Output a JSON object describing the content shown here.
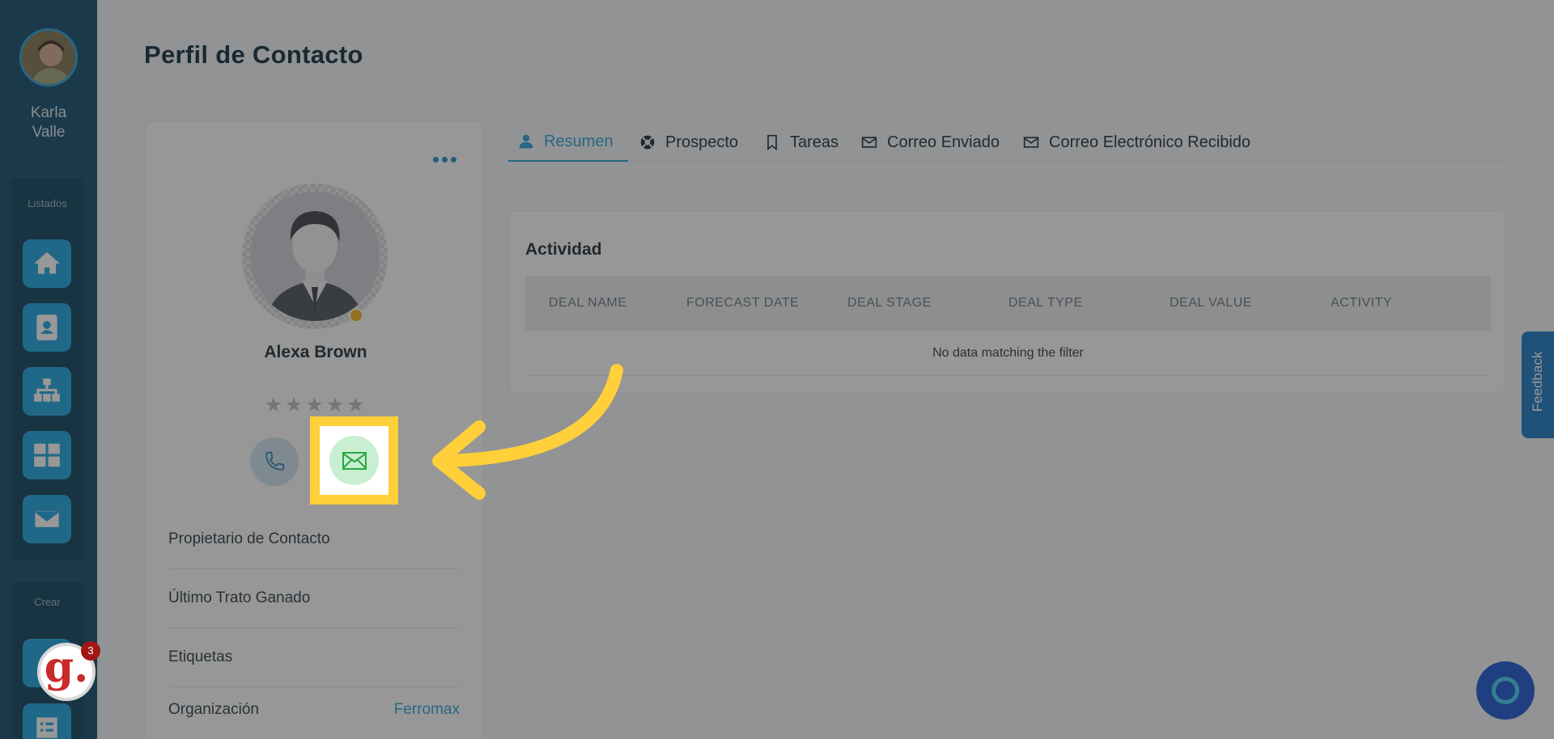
{
  "sidebar": {
    "user_name": "Karla Valle",
    "list_label": "Listados",
    "create_label": "Crear",
    "items": [
      {
        "icon": "home-icon"
      },
      {
        "icon": "contact-card-icon"
      },
      {
        "icon": "org-chart-icon"
      },
      {
        "icon": "grid-icon"
      },
      {
        "icon": "mail-icon"
      }
    ]
  },
  "page": {
    "title": "Perfil de Contacto"
  },
  "contact": {
    "name": "Alexa Brown",
    "rating": "★★★★★",
    "fields": [
      {
        "label": "Propietario de Contacto",
        "value": ""
      },
      {
        "label": "Último Trato Ganado",
        "value": ""
      },
      {
        "label": "Etiquetas",
        "value": ""
      },
      {
        "label": "Organización",
        "value": "Ferromax"
      }
    ]
  },
  "tabs": [
    {
      "label": "Resumen",
      "icon": "user-icon"
    },
    {
      "label": "Prospecto",
      "icon": "lifebuoy-icon"
    },
    {
      "label": "Tareas",
      "icon": "bookmark-icon"
    },
    {
      "label": "Correo Enviado",
      "icon": "mail-icon"
    },
    {
      "label": "Correo Electrónico Recibido",
      "icon": "mail-icon"
    }
  ],
  "activity": {
    "title": "Actividad",
    "columns": [
      "DEAL NAME",
      "FORECAST DATE",
      "DEAL STAGE",
      "DEAL TYPE",
      "DEAL VALUE",
      "ACTIVITY"
    ],
    "empty_message": "No data matching the filter"
  },
  "feedback": {
    "label": "Feedback"
  },
  "guide": {
    "letter": "g.",
    "count": "3"
  },
  "colors": {
    "accent": "#2a9fd6",
    "sidebar": "#0f4c6b",
    "highlight": "#ffd03a",
    "email_green": "#28a745"
  }
}
